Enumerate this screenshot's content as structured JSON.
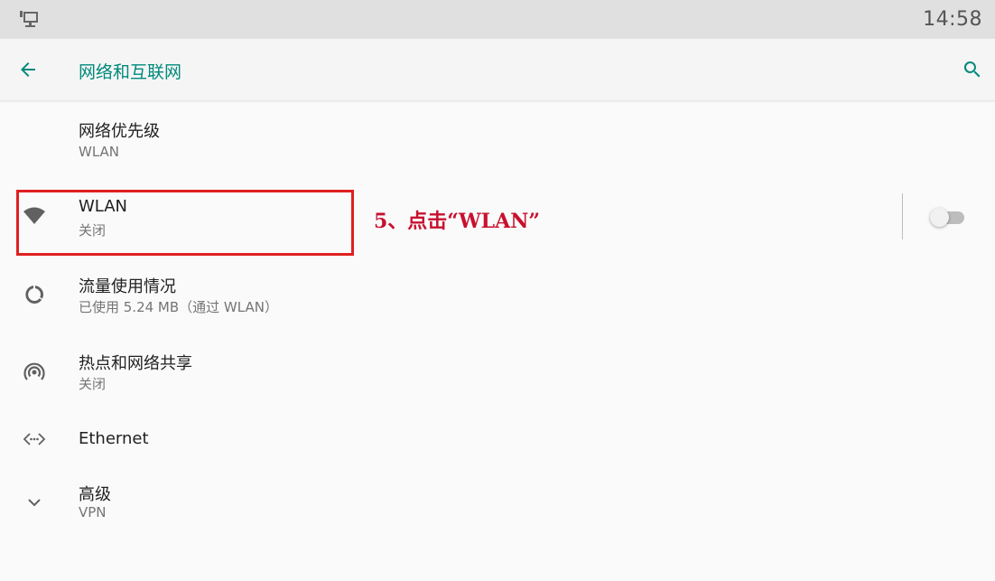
{
  "status_bar": {
    "time": "14:58",
    "left_icon": "desktop-network-icon"
  },
  "app_bar": {
    "title": "网络和互联网",
    "back_icon": "arrow-back-icon",
    "search_icon": "search-icon",
    "accent_color": "#00897b"
  },
  "items": [
    {
      "title": "网络优先级",
      "summary": "WLAN",
      "icon": ""
    },
    {
      "title": "WLAN",
      "summary": "关闭",
      "icon": "wifi-icon",
      "switch_on": false
    },
    {
      "title": "流量使用情况",
      "summary": "已使用 5.24 MB（通过 WLAN）",
      "icon": "data-usage-icon"
    },
    {
      "title": "热点和网络共享",
      "summary": "关闭",
      "icon": "hotspot-icon"
    },
    {
      "title": "Ethernet",
      "summary": "",
      "icon": "ethernet-icon"
    },
    {
      "title": "高级",
      "summary": "VPN",
      "icon": "chevron-down-icon"
    }
  ],
  "annotation": {
    "text": "5、点击“WLAN”",
    "color": "#c8102e"
  }
}
